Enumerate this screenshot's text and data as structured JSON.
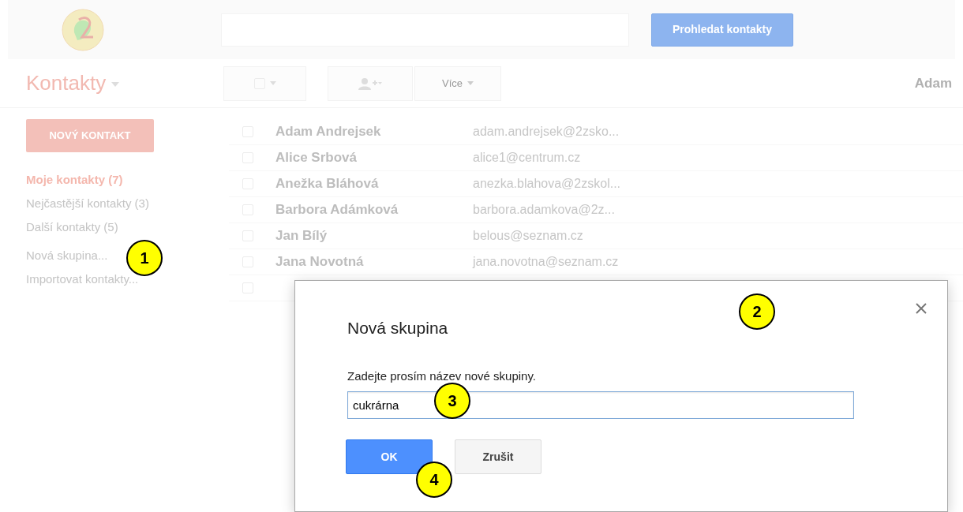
{
  "header": {
    "search_button": "Prohledat kontakty"
  },
  "toolbar": {
    "title": "Kontakty",
    "select_all_checked": false,
    "more_button": "Více",
    "user": "Adam"
  },
  "sidebar": {
    "new_contact_button": "NOVÝ KONTAKT",
    "groups": [
      {
        "label": "Moje kontakty (7)",
        "selected": true
      },
      {
        "label": "Nejčastější kontakty (3)",
        "selected": false
      },
      {
        "label": "Další kontakty (5)",
        "selected": false
      }
    ],
    "actions": [
      "Nová skupina...",
      "Importovat kontakty..."
    ]
  },
  "contacts": [
    {
      "name": "Adam Andrejsek",
      "email": "adam.andrejsek@2zsko...",
      "checked": false
    },
    {
      "name": "Alice Srbová",
      "email": "alice1@centrum.cz",
      "checked": false
    },
    {
      "name": "Anežka Bláhová",
      "email": "anezka.blahova@2zskol...",
      "checked": false
    },
    {
      "name": "Barbora Adámková",
      "email": "barbora.adamkova@2z...",
      "checked": false
    },
    {
      "name": "Jan Bílý",
      "email": "belous@seznam.cz",
      "checked": false
    },
    {
      "name": "Jana Novotná",
      "email": "jana.novotna@seznam.cz",
      "checked": false
    },
    {
      "checked": false
    }
  ],
  "dialog": {
    "title": "Nová skupina",
    "prompt": "Zadejte prosím název nové skupiny.",
    "value": "cukrárna",
    "buttons": [
      {
        "label": "OK",
        "kind": "primary"
      },
      {
        "label": "Zrušit",
        "kind": "secondary"
      }
    ]
  },
  "callouts": [
    "1",
    "2",
    "3",
    "4"
  ]
}
